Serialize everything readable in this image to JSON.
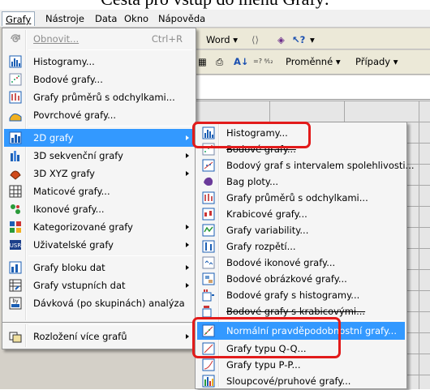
{
  "caption": "Cesta pro vstup do menu Grafy:",
  "menubar": [
    {
      "label": "Grafy"
    },
    {
      "label": "Nástroje"
    },
    {
      "label": "Data"
    },
    {
      "label": "Okno"
    },
    {
      "label": "Nápověda"
    }
  ],
  "toolbar": {
    "word_label": "Word",
    "variables_label": "Proměnné",
    "cases_label": "Případy"
  },
  "grafy_menu": [
    {
      "label": "Obnovit...",
      "shortcut": "Ctrl+R",
      "icon": "refresh-icon"
    },
    {
      "label": "Histogramy...",
      "icon": "histogram-icon"
    },
    {
      "label": "Bodové grafy...",
      "icon": "scatterplot-icon"
    },
    {
      "label": "Grafy průměrů s odchylkami...",
      "icon": "means-icon"
    },
    {
      "label": "Povrchové grafy...",
      "icon": "surface-icon"
    },
    {
      "label": "2D grafy",
      "icon": "2d-graph-icon"
    },
    {
      "label": "3D sekvenční grafy",
      "icon": "3d-sequential-icon"
    },
    {
      "label": "3D XYZ grafy",
      "icon": "3d-xyz-icon"
    },
    {
      "label": "Maticové grafy...",
      "icon": "matrix-icon"
    },
    {
      "label": "Ikonové grafy...",
      "icon": "icon-plot-icon"
    },
    {
      "label": "Kategorizované grafy",
      "icon": "categorized-icon"
    },
    {
      "label": "Uživatelské grafy",
      "icon": "user-graph-icon"
    },
    {
      "label": "Grafy bloku dat",
      "icon": "block-data-icon"
    },
    {
      "label": "Grafy vstupních dat",
      "icon": "input-data-icon"
    },
    {
      "label": "Dávková (po skupinách) analýza",
      "icon": "batch-icon"
    },
    {
      "label": "Rozložení více grafů",
      "icon": "multi-graph-icon"
    }
  ],
  "submenu_2d": [
    {
      "label": "Histogramy...",
      "icon": "histogram-icon"
    },
    {
      "label": "Bodové grafy...",
      "icon": "scatterplot-icon"
    },
    {
      "label": "Bodový graf s intervalem spolehlivosti...",
      "icon": "scatter-ci-icon"
    },
    {
      "label": "Bag ploty...",
      "icon": "bag-plot-icon"
    },
    {
      "label": "Grafy průměrů s odchylkami...",
      "icon": "means-icon"
    },
    {
      "label": "Krabicové grafy...",
      "icon": "box-plot-icon"
    },
    {
      "label": "Grafy variability...",
      "icon": "variability-icon"
    },
    {
      "label": "Grafy rozpětí...",
      "icon": "range-icon"
    },
    {
      "label": "Bodové ikonové grafy...",
      "icon": "icon-scatter-icon"
    },
    {
      "label": "Bodové obrázkové grafy...",
      "icon": "image-scatter-icon"
    },
    {
      "label": "Bodové grafy s histogramy...",
      "icon": "scatter-hist-icon"
    },
    {
      "label": "Bodové grafy s krabicovými...",
      "icon": "scatter-box-icon"
    },
    {
      "label": "Normální pravděpodobnostní grafy...",
      "icon": "normal-prob-icon"
    },
    {
      "label": "Grafy typu Q-Q...",
      "icon": "qq-icon"
    },
    {
      "label": "Grafy typu P-P...",
      "icon": "pp-icon"
    },
    {
      "label": "Sloupcové/pruhové grafy...",
      "icon": "bar-chart-icon"
    }
  ],
  "colors": {
    "selection": "#3399ff",
    "highlight_box": "#e21b1b",
    "menu_bg": "#f5f5f5"
  }
}
